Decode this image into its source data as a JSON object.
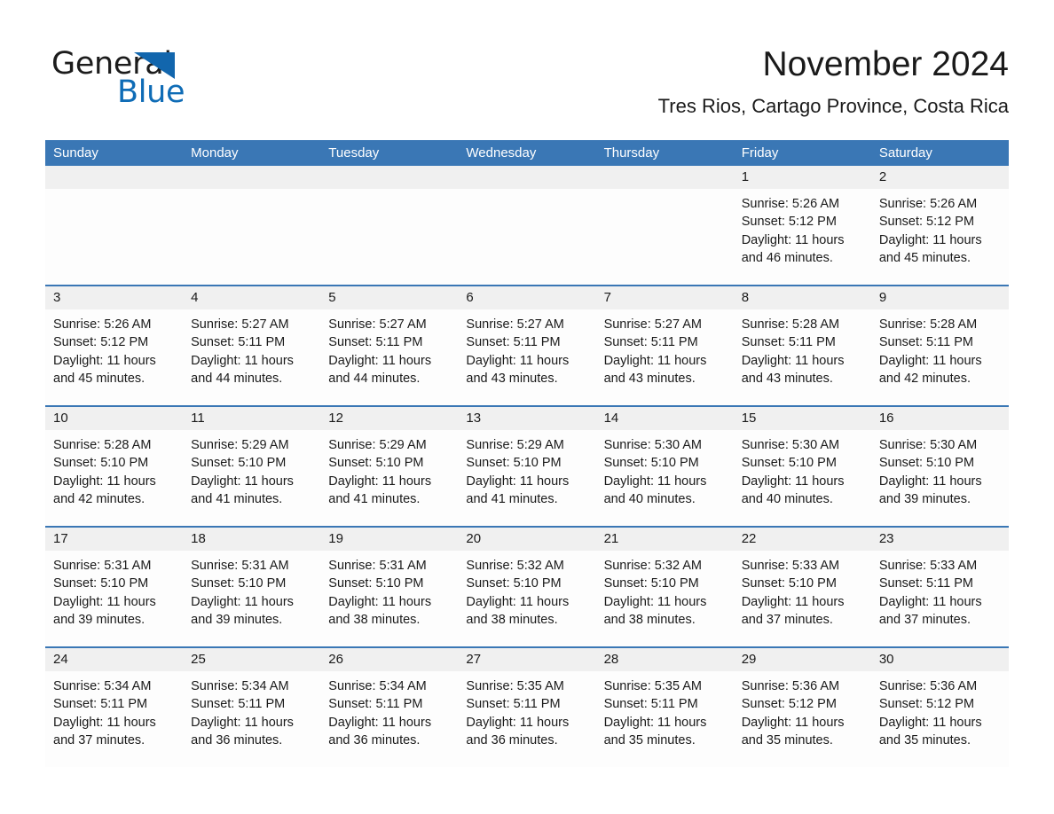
{
  "brand": {
    "name_part1": "General",
    "name_part2": "Blue",
    "triangle_color": "#1266ad",
    "blue_color": "#0f6cb6"
  },
  "header": {
    "title": "November 2024",
    "subtitle": "Tres Rios, Cartago Province, Costa Rica",
    "accent_color": "#3a77b5",
    "band_color": "#f0f0f0"
  },
  "weekdays": [
    "Sunday",
    "Monday",
    "Tuesday",
    "Wednesday",
    "Thursday",
    "Friday",
    "Saturday"
  ],
  "weeks": [
    {
      "days": [
        {
          "date": "",
          "empty": true
        },
        {
          "date": "",
          "empty": true
        },
        {
          "date": "",
          "empty": true
        },
        {
          "date": "",
          "empty": true
        },
        {
          "date": "",
          "empty": true
        },
        {
          "date": "1",
          "sunrise": "Sunrise: 5:26 AM",
          "sunset": "Sunset: 5:12 PM",
          "daylight": "Daylight: 11 hours and 46 minutes."
        },
        {
          "date": "2",
          "sunrise": "Sunrise: 5:26 AM",
          "sunset": "Sunset: 5:12 PM",
          "daylight": "Daylight: 11 hours and 45 minutes."
        }
      ]
    },
    {
      "days": [
        {
          "date": "3",
          "sunrise": "Sunrise: 5:26 AM",
          "sunset": "Sunset: 5:12 PM",
          "daylight": "Daylight: 11 hours and 45 minutes."
        },
        {
          "date": "4",
          "sunrise": "Sunrise: 5:27 AM",
          "sunset": "Sunset: 5:11 PM",
          "daylight": "Daylight: 11 hours and 44 minutes."
        },
        {
          "date": "5",
          "sunrise": "Sunrise: 5:27 AM",
          "sunset": "Sunset: 5:11 PM",
          "daylight": "Daylight: 11 hours and 44 minutes."
        },
        {
          "date": "6",
          "sunrise": "Sunrise: 5:27 AM",
          "sunset": "Sunset: 5:11 PM",
          "daylight": "Daylight: 11 hours and 43 minutes."
        },
        {
          "date": "7",
          "sunrise": "Sunrise: 5:27 AM",
          "sunset": "Sunset: 5:11 PM",
          "daylight": "Daylight: 11 hours and 43 minutes."
        },
        {
          "date": "8",
          "sunrise": "Sunrise: 5:28 AM",
          "sunset": "Sunset: 5:11 PM",
          "daylight": "Daylight: 11 hours and 43 minutes."
        },
        {
          "date": "9",
          "sunrise": "Sunrise: 5:28 AM",
          "sunset": "Sunset: 5:11 PM",
          "daylight": "Daylight: 11 hours and 42 minutes."
        }
      ]
    },
    {
      "days": [
        {
          "date": "10",
          "sunrise": "Sunrise: 5:28 AM",
          "sunset": "Sunset: 5:10 PM",
          "daylight": "Daylight: 11 hours and 42 minutes."
        },
        {
          "date": "11",
          "sunrise": "Sunrise: 5:29 AM",
          "sunset": "Sunset: 5:10 PM",
          "daylight": "Daylight: 11 hours and 41 minutes."
        },
        {
          "date": "12",
          "sunrise": "Sunrise: 5:29 AM",
          "sunset": "Sunset: 5:10 PM",
          "daylight": "Daylight: 11 hours and 41 minutes."
        },
        {
          "date": "13",
          "sunrise": "Sunrise: 5:29 AM",
          "sunset": "Sunset: 5:10 PM",
          "daylight": "Daylight: 11 hours and 41 minutes."
        },
        {
          "date": "14",
          "sunrise": "Sunrise: 5:30 AM",
          "sunset": "Sunset: 5:10 PM",
          "daylight": "Daylight: 11 hours and 40 minutes."
        },
        {
          "date": "15",
          "sunrise": "Sunrise: 5:30 AM",
          "sunset": "Sunset: 5:10 PM",
          "daylight": "Daylight: 11 hours and 40 minutes."
        },
        {
          "date": "16",
          "sunrise": "Sunrise: 5:30 AM",
          "sunset": "Sunset: 5:10 PM",
          "daylight": "Daylight: 11 hours and 39 minutes."
        }
      ]
    },
    {
      "days": [
        {
          "date": "17",
          "sunrise": "Sunrise: 5:31 AM",
          "sunset": "Sunset: 5:10 PM",
          "daylight": "Daylight: 11 hours and 39 minutes."
        },
        {
          "date": "18",
          "sunrise": "Sunrise: 5:31 AM",
          "sunset": "Sunset: 5:10 PM",
          "daylight": "Daylight: 11 hours and 39 minutes."
        },
        {
          "date": "19",
          "sunrise": "Sunrise: 5:31 AM",
          "sunset": "Sunset: 5:10 PM",
          "daylight": "Daylight: 11 hours and 38 minutes."
        },
        {
          "date": "20",
          "sunrise": "Sunrise: 5:32 AM",
          "sunset": "Sunset: 5:10 PM",
          "daylight": "Daylight: 11 hours and 38 minutes."
        },
        {
          "date": "21",
          "sunrise": "Sunrise: 5:32 AM",
          "sunset": "Sunset: 5:10 PM",
          "daylight": "Daylight: 11 hours and 38 minutes."
        },
        {
          "date": "22",
          "sunrise": "Sunrise: 5:33 AM",
          "sunset": "Sunset: 5:10 PM",
          "daylight": "Daylight: 11 hours and 37 minutes."
        },
        {
          "date": "23",
          "sunrise": "Sunrise: 5:33 AM",
          "sunset": "Sunset: 5:11 PM",
          "daylight": "Daylight: 11 hours and 37 minutes."
        }
      ]
    },
    {
      "days": [
        {
          "date": "24",
          "sunrise": "Sunrise: 5:34 AM",
          "sunset": "Sunset: 5:11 PM",
          "daylight": "Daylight: 11 hours and 37 minutes."
        },
        {
          "date": "25",
          "sunrise": "Sunrise: 5:34 AM",
          "sunset": "Sunset: 5:11 PM",
          "daylight": "Daylight: 11 hours and 36 minutes."
        },
        {
          "date": "26",
          "sunrise": "Sunrise: 5:34 AM",
          "sunset": "Sunset: 5:11 PM",
          "daylight": "Daylight: 11 hours and 36 minutes."
        },
        {
          "date": "27",
          "sunrise": "Sunrise: 5:35 AM",
          "sunset": "Sunset: 5:11 PM",
          "daylight": "Daylight: 11 hours and 36 minutes."
        },
        {
          "date": "28",
          "sunrise": "Sunrise: 5:35 AM",
          "sunset": "Sunset: 5:11 PM",
          "daylight": "Daylight: 11 hours and 35 minutes."
        },
        {
          "date": "29",
          "sunrise": "Sunrise: 5:36 AM",
          "sunset": "Sunset: 5:12 PM",
          "daylight": "Daylight: 11 hours and 35 minutes."
        },
        {
          "date": "30",
          "sunrise": "Sunrise: 5:36 AM",
          "sunset": "Sunset: 5:12 PM",
          "daylight": "Daylight: 11 hours and 35 minutes."
        }
      ]
    }
  ]
}
